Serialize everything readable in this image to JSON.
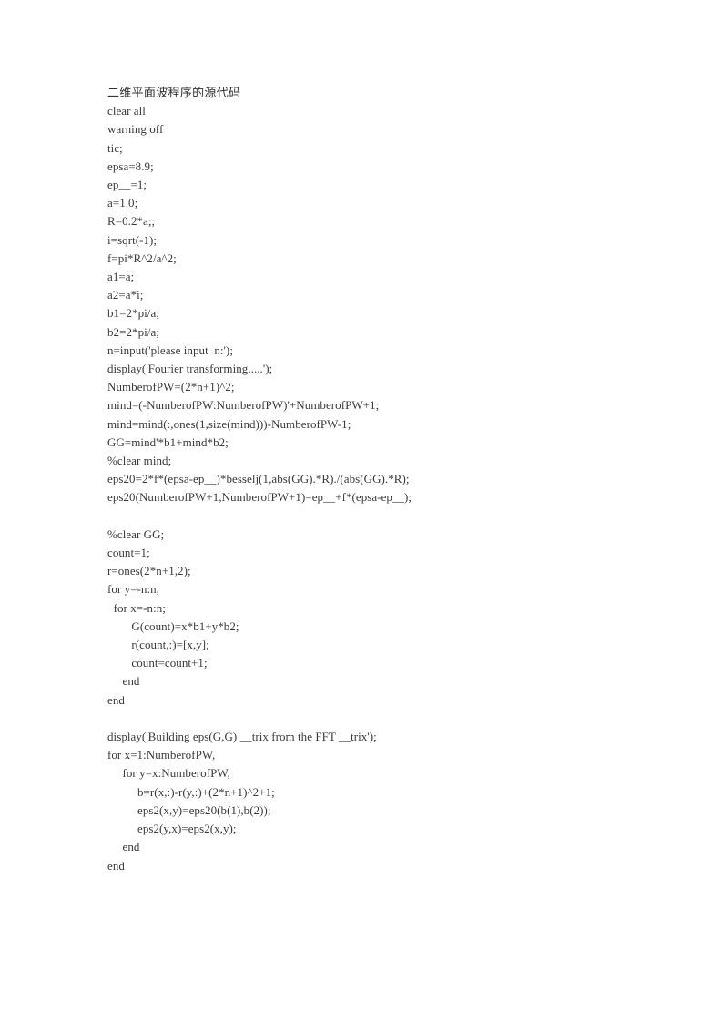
{
  "document": {
    "title": "二维平面波程序的源代码",
    "language": "matlab",
    "page_background": "#ffffff",
    "text_color": "#3a3a3a",
    "lines": [
      "二维平面波程序的源代码",
      "clear all",
      "warning off",
      "tic;",
      "epsa=8.9;",
      "ep__=1;",
      "a=1.0;",
      "R=0.2*a;;",
      "i=sqrt(-1);",
      "f=pi*R^2/a^2;",
      "a1=a;",
      "a2=a*i;",
      "b1=2*pi/a;",
      "b2=2*pi/a;",
      "n=input('please input  n:');",
      "display('Fourier transforming.....');",
      "NumberofPW=(2*n+1)^2;",
      "mind=(-NumberofPW:NumberofPW)'+NumberofPW+1;",
      "mind=mind(:,ones(1,size(mind)))-NumberofPW-1;",
      "GG=mind'*b1+mind*b2;",
      "%clear mind;",
      "eps20=2*f*(epsa-ep__)*besselj(1,abs(GG).*R)./(abs(GG).*R);",
      "eps20(NumberofPW+1,NumberofPW+1)=ep__+f*(epsa-ep__);",
      "",
      "%clear GG;",
      "count=1;",
      "r=ones(2*n+1,2);",
      "for y=-n:n,",
      "  for x=-n:n;",
      "        G(count)=x*b1+y*b2;",
      "        r(count,:)=[x,y];",
      "        count=count+1;",
      "     end",
      "end",
      "",
      "display('Building eps(G,G) __trix from the FFT __trix');",
      "for x=1:NumberofPW,",
      "     for y=x:NumberofPW,",
      "          b=r(x,:)-r(y,:)+(2*n+1)^2+1;",
      "          eps2(x,y)=eps20(b(1),b(2));",
      "          eps2(y,x)=eps2(x,y);",
      "     end",
      "end"
    ]
  }
}
